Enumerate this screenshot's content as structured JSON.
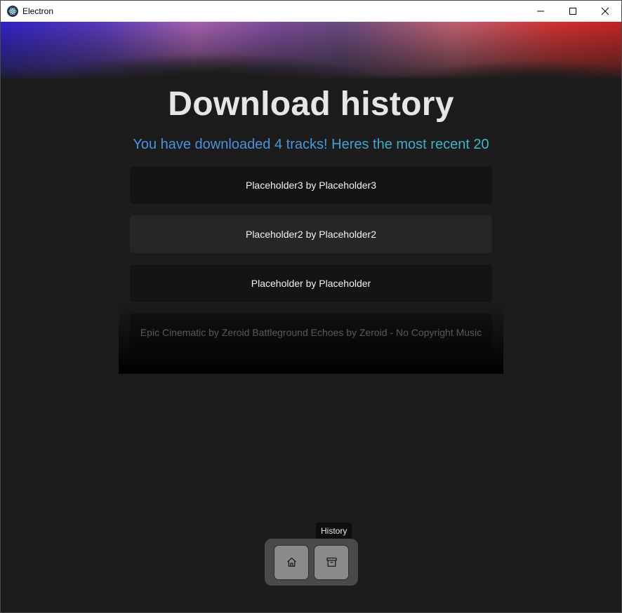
{
  "window": {
    "title": "Electron"
  },
  "page": {
    "title": "Download history",
    "subtitle": "You have downloaded 4 tracks! Heres the most recent 20"
  },
  "tracks": [
    {
      "label": "Placeholder3 by Placeholder3"
    },
    {
      "label": "Placeholder2 by Placeholder2"
    },
    {
      "label": "Placeholder by Placeholder"
    },
    {
      "label": "Epic Cinematic by Zeroid Battleground Echoes by Zeroid - No Copyright Music"
    }
  ],
  "dock": {
    "buttons": [
      {
        "icon": "home-icon"
      },
      {
        "icon": "archive-icon"
      }
    ],
    "tooltip": "History"
  },
  "colors": {
    "background": "#1c1c1c",
    "card": "#141414",
    "card_hover": "#262626",
    "dock": "#4a4a4a",
    "dock_button": "#8a8a8a"
  }
}
